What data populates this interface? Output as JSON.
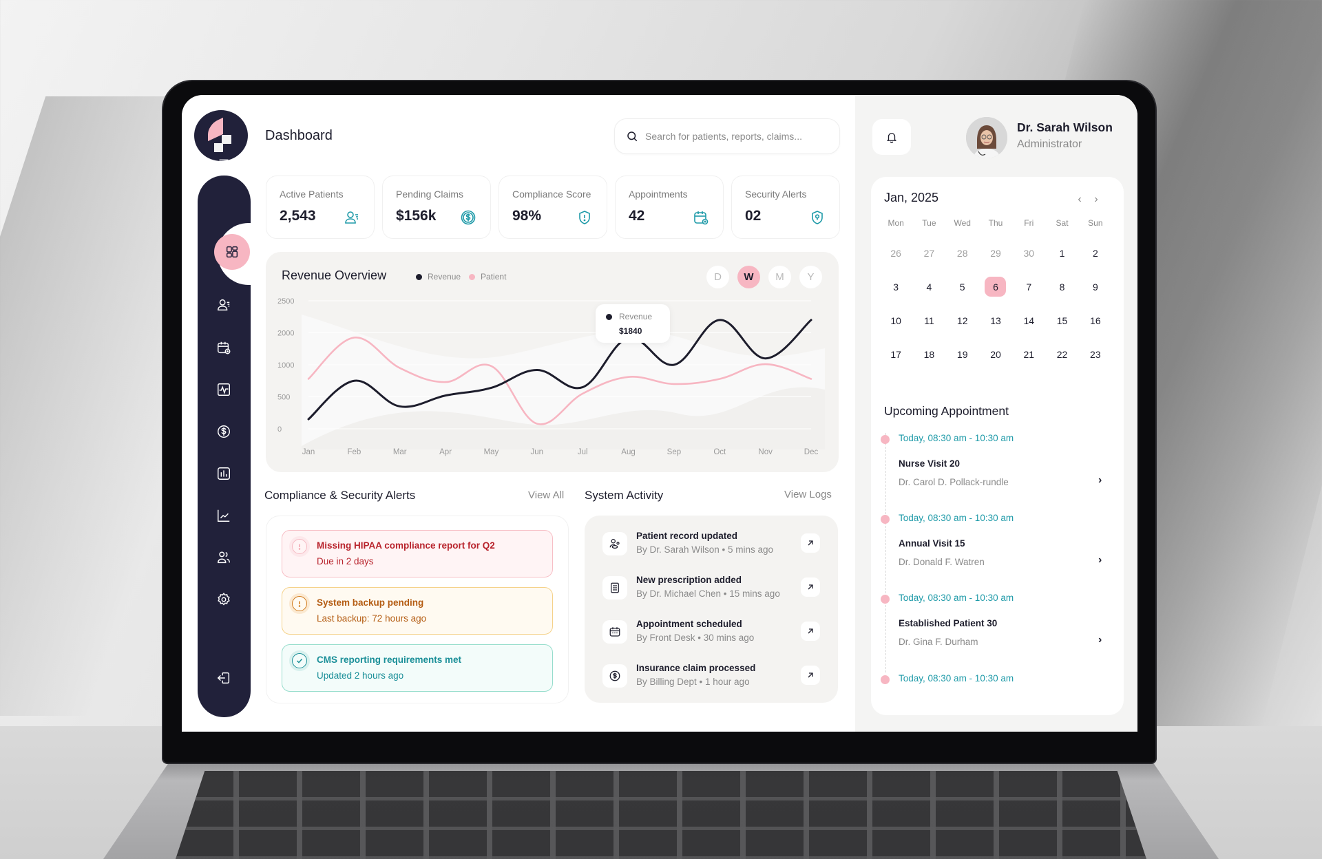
{
  "header": {
    "title": "Dashboard",
    "search_placeholder": "Search for patients, reports, claims..."
  },
  "user": {
    "name": "Dr. Sarah Wilson",
    "role": "Administrator"
  },
  "sidebar": {
    "items": [
      {
        "icon": "menu-icon"
      },
      {
        "icon": "dashboard-grid-icon",
        "active": true
      },
      {
        "icon": "patients-icon"
      },
      {
        "icon": "calendar-add-icon"
      },
      {
        "icon": "monitor-pulse-icon"
      },
      {
        "icon": "dollar-icon"
      },
      {
        "icon": "bar-chart-icon"
      },
      {
        "icon": "line-chart-icon"
      },
      {
        "icon": "users-icon"
      },
      {
        "icon": "settings-icon"
      },
      {
        "icon": "logout-icon"
      }
    ]
  },
  "stats": [
    {
      "label": "Active Patients",
      "value": "2,543",
      "icon": "patients-icon"
    },
    {
      "label": "Pending Claims",
      "value": "$156k",
      "icon": "dollar-circle-icon"
    },
    {
      "label": "Compliance Score",
      "value": "98%",
      "icon": "shield-alert-icon"
    },
    {
      "label": "Appointments",
      "value": "42",
      "icon": "calendar-add-icon"
    },
    {
      "label": "Security Alerts",
      "value": "02",
      "icon": "shield-pin-icon"
    }
  ],
  "revenue_overview": {
    "title": "Revenue Overview",
    "legend": [
      "Revenue",
      "Patient"
    ],
    "ranges": [
      "D",
      "W",
      "M",
      "Y"
    ],
    "active_range": "W",
    "tooltip": {
      "label": "Revenue",
      "value": "$1840"
    }
  },
  "chart_data": {
    "type": "line",
    "title": "Revenue Overview",
    "xlabel": "",
    "ylabel": "",
    "categories": [
      "Jan",
      "Feb",
      "Mar",
      "Apr",
      "May",
      "Jun",
      "Jul",
      "Aug",
      "Sep",
      "Oct",
      "Nov",
      "Dec"
    ],
    "y_tick_labels": [
      "2500",
      "2000",
      "1000",
      "500",
      "0"
    ],
    "y_tick_values": [
      2500,
      2000,
      1000,
      500,
      0
    ],
    "ylim": [
      0,
      2500
    ],
    "grid": true,
    "legend_position": "top-left",
    "series": [
      {
        "name": "Revenue",
        "color": "#1d1d2c",
        "values": [
          150,
          750,
          350,
          520,
          640,
          920,
          650,
          1840,
          1000,
          2200,
          1200,
          2200
        ]
      },
      {
        "name": "Patient",
        "color": "#f7b6c2",
        "values": [
          780,
          1850,
          950,
          730,
          980,
          80,
          550,
          810,
          700,
          780,
          1020,
          780
        ]
      }
    ],
    "annotations": [
      {
        "x": "Aug",
        "series": "Revenue",
        "text": "$1840"
      }
    ]
  },
  "alerts": {
    "title": "Compliance & Security Alerts",
    "view_all": "View All",
    "items": [
      {
        "title": "Missing HIPAA compliance report for Q2",
        "subtitle": "Due in 2 days",
        "level": "error"
      },
      {
        "title": "System backup pending",
        "subtitle": "Last backup: 72 hours ago",
        "level": "warning"
      },
      {
        "title": "CMS reporting requirements met",
        "subtitle": "Updated 2 hours ago",
        "level": "success"
      }
    ]
  },
  "activity": {
    "title": "System Activity",
    "view_logs": "View Logs",
    "items": [
      {
        "title": "Patient record updated",
        "subtitle": "By Dr. Sarah Wilson • 5 mins ago",
        "icon": "user-record-icon"
      },
      {
        "title": "New prescription added",
        "subtitle": "By Dr. Michael Chen • 15 mins ago",
        "icon": "prescription-icon"
      },
      {
        "title": "Appointment scheduled",
        "subtitle": "By Front Desk • 30 mins ago",
        "icon": "calendar-icon"
      },
      {
        "title": "Insurance claim processed",
        "subtitle": "By Billing Dept • 1 hour ago",
        "icon": "dollar-circle-icon"
      }
    ]
  },
  "calendar": {
    "title": "Jan, 2025",
    "weekdays": [
      "Mon",
      "Tue",
      "Wed",
      "Thu",
      "Fri",
      "Sat",
      "Sun"
    ],
    "weeks": [
      [
        {
          "d": "26",
          "muted": true
        },
        {
          "d": "27",
          "muted": true
        },
        {
          "d": "28",
          "muted": true
        },
        {
          "d": "29",
          "muted": true
        },
        {
          "d": "30",
          "muted": true
        },
        {
          "d": "1"
        },
        {
          "d": "2"
        }
      ],
      [
        {
          "d": "3"
        },
        {
          "d": "4"
        },
        {
          "d": "5"
        },
        {
          "d": "6",
          "today": true
        },
        {
          "d": "7"
        },
        {
          "d": "8"
        },
        {
          "d": "9"
        }
      ],
      [
        {
          "d": "10"
        },
        {
          "d": "11"
        },
        {
          "d": "12"
        },
        {
          "d": "13"
        },
        {
          "d": "14"
        },
        {
          "d": "15"
        },
        {
          "d": "16"
        }
      ],
      [
        {
          "d": "17"
        },
        {
          "d": "18"
        },
        {
          "d": "19"
        },
        {
          "d": "20"
        },
        {
          "d": "21"
        },
        {
          "d": "22"
        },
        {
          "d": "23"
        }
      ]
    ]
  },
  "appointments": {
    "title": "Upcoming Appointment",
    "items": [
      {
        "time": "Today, 08:30 am - 10:30 am",
        "name": "Nurse Visit 20",
        "doctor": "Dr. Carol D. Pollack-rundle"
      },
      {
        "time": "Today, 08:30 am - 10:30 am",
        "name": "Annual Visit 15",
        "doctor": "Dr. Donald F. Watren"
      },
      {
        "time": "Today, 08:30 am - 10:30 am",
        "name": "Established Patient 30",
        "doctor": "Dr. Gina F. Durham"
      },
      {
        "time": "Today, 08:30 am - 10:30 am"
      }
    ]
  }
}
